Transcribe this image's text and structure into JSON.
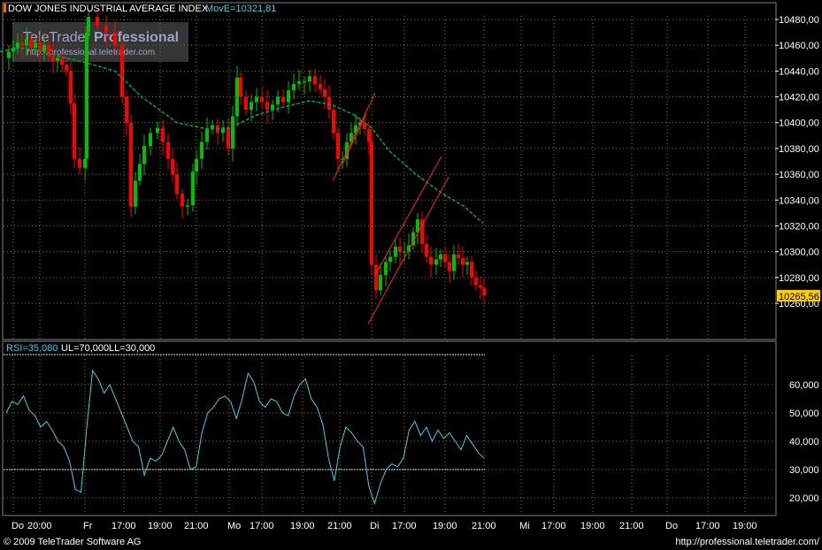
{
  "header": {
    "title": "DOW JONES INDUSTRIAL AVERAGE INDEX",
    "mov_label": "MovE=10321,81",
    "watermark_title_a": "TeleTrader",
    "watermark_title_b": "Professional",
    "watermark_url": "http://professional.teletrader.com"
  },
  "rsi_header": {
    "rsi": "RSI=35,080",
    "ul": "UL=70,000",
    "ll": "LL=30,000"
  },
  "footer": {
    "copyright": "© 2009 TeleTrader Software AG",
    "url": "http://professional.teletrader.com/"
  },
  "colors": {
    "up": "#00c000",
    "down": "#ff0000",
    "ma": "#00a050",
    "rsi": "#40d0e0",
    "channel": "#ff2020",
    "grid": "#808000",
    "last_price_bg": "#ffd000"
  },
  "chart_data": [
    {
      "type": "candlestick",
      "title": "DOW JONES INDUSTRIAL AVERAGE INDEX",
      "ylim": [
        10240,
        10490
      ],
      "y_ticks": [
        "10480,00",
        "10460,00",
        "10440,00",
        "10420,00",
        "10400,00",
        "10380,00",
        "10360,00",
        "10340,00",
        "10320,00",
        "10300,00",
        "10280,00",
        "10260,00"
      ],
      "y_tick_values": [
        10480,
        10460,
        10440,
        10420,
        10400,
        10380,
        10360,
        10340,
        10320,
        10300,
        10280,
        10260
      ],
      "last_price": "10265,56",
      "last_value": 10265.56,
      "x_labels": [
        "Do",
        "20:00",
        "Fr",
        "17:00",
        "19:00",
        "21:00",
        "Mo",
        "17:00",
        "19:00",
        "21:00",
        "Di",
        "17:00",
        "19:00",
        "21:00",
        "Mi",
        "17:00",
        "19:00",
        "21:00",
        "Do",
        "17:00",
        "19:00"
      ],
      "moving_average": [
        [
          0,
          10455
        ],
        [
          20,
          10458
        ],
        [
          45,
          10456
        ],
        [
          75,
          10450
        ],
        [
          100,
          10446
        ],
        [
          130,
          10440
        ],
        [
          160,
          10420
        ],
        [
          200,
          10400
        ],
        [
          235,
          10395
        ],
        [
          260,
          10396
        ],
        [
          290,
          10406
        ],
        [
          320,
          10412
        ],
        [
          350,
          10417
        ],
        [
          375,
          10414
        ],
        [
          400,
          10406
        ],
        [
          420,
          10396
        ],
        [
          440,
          10378
        ],
        [
          470,
          10360
        ],
        [
          500,
          10345
        ],
        [
          525,
          10335
        ],
        [
          546,
          10322
        ]
      ],
      "channels": [
        [
          [
            376,
            10355
          ],
          [
            424,
            10423
          ]
        ],
        [
          [
            387,
            10368
          ],
          [
            414,
            10407
          ]
        ],
        [
          [
            416,
            10244
          ],
          [
            507,
            10358
          ]
        ],
        [
          [
            424,
            10282
          ],
          [
            499,
            10374
          ]
        ]
      ]
    },
    {
      "type": "line",
      "title": "RSI",
      "ylim": [
        15,
        70
      ],
      "y_ticks": [
        "60,000",
        "50,000",
        "40,000",
        "30,000",
        "20,000"
      ],
      "y_tick_values": [
        60,
        50,
        40,
        30,
        20
      ],
      "upper_limit": 70,
      "lower_limit": 30,
      "values": [
        50,
        54,
        53,
        56,
        51,
        49,
        45,
        47,
        44,
        40,
        38,
        33,
        23,
        22,
        45,
        65,
        62,
        57,
        60,
        55,
        50,
        45,
        40,
        38,
        28,
        34,
        33,
        35,
        40,
        45,
        40,
        37,
        30,
        31,
        43,
        50,
        52,
        55,
        56,
        54,
        48,
        55,
        64,
        61,
        54,
        52,
        55,
        54,
        50,
        49,
        56,
        60,
        62,
        55,
        52,
        46,
        34,
        26,
        38,
        45,
        43,
        40,
        38,
        24,
        18,
        25,
        30,
        32,
        31,
        34,
        44,
        47,
        42,
        45,
        40,
        44,
        41,
        43,
        40,
        37,
        42,
        39,
        36,
        34
      ]
    }
  ]
}
